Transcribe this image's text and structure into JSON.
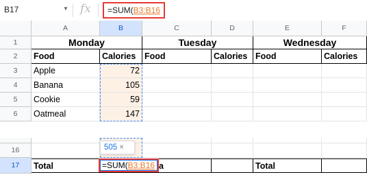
{
  "formula_bar": {
    "name_box": "B17",
    "fx_icon": "fx",
    "formula_prefix": "=SUM(",
    "formula_ref": "B3:B16"
  },
  "columns": [
    "A",
    "B",
    "C",
    "D",
    "E",
    "F"
  ],
  "rows": {
    "r1": {
      "num": "1",
      "monday": "Monday",
      "tuesday": "Tuesday",
      "wednesday": "Wednesday"
    },
    "r2": {
      "num": "2",
      "a": "Food",
      "b": "Calories",
      "c": "Food",
      "d": "Calories",
      "e": "Food",
      "f": "Calories"
    },
    "r3": {
      "num": "3",
      "a": "Apple",
      "b": "72"
    },
    "r4": {
      "num": "4",
      "a": "Banana",
      "b": "105"
    },
    "r5": {
      "num": "5",
      "a": "Cookie",
      "b": "59"
    },
    "r6": {
      "num": "6",
      "a": "Oatmeal",
      "b": "147"
    },
    "r16": {
      "num": "16"
    },
    "r17": {
      "num": "17",
      "a": "Total",
      "e": "Total",
      "b_suffix": "a"
    }
  },
  "tooltip": {
    "value": "505",
    "close": "×"
  },
  "editor": {
    "prefix": "=SUM(",
    "ref": "B3:B16"
  }
}
